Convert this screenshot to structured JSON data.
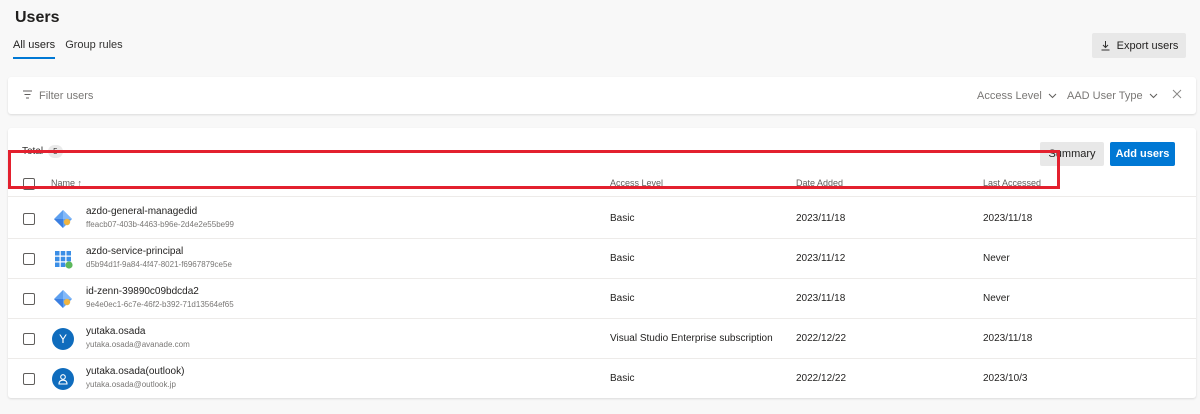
{
  "page": {
    "title": "Users"
  },
  "tabs": [
    {
      "label": "All users",
      "active": true
    },
    {
      "label": "Group rules",
      "active": false
    }
  ],
  "toolbar": {
    "export_label": "Export users"
  },
  "filter": {
    "placeholder": "Filter users",
    "access_level_label": "Access Level",
    "aad_user_type_label": "AAD User Type"
  },
  "summary": {
    "total_label": "Total",
    "total_count": "5",
    "summary_label": "Summary",
    "add_label": "Add users"
  },
  "columns": {
    "name": "Name ↑",
    "access": "Access Level",
    "date_added": "Date Added",
    "last_accessed": "Last Accessed"
  },
  "users": [
    {
      "name": "azdo-general-managedid",
      "id": "ffeacb07-403b-4463-b96e-2d4e2e55be99",
      "access": "Basic",
      "date_added": "2023/11/18",
      "last_accessed": "2023/11/18",
      "avatar": "managed-identity-icon"
    },
    {
      "name": "azdo-service-principal",
      "id": "d5b94d1f-9a84-4f47-8021-f6967879ce5e",
      "access": "Basic",
      "date_added": "2023/11/12",
      "last_accessed": "Never",
      "avatar": "service-principal-icon"
    },
    {
      "name": "id-zenn-39890c09bdcda2",
      "id": "9e4e0ec1-6c7e-46f2-b392-71d13564ef65",
      "access": "Basic",
      "date_added": "2023/11/18",
      "last_accessed": "Never",
      "avatar": "managed-identity-icon"
    },
    {
      "name": "yutaka.osada",
      "id": "yutaka.osada@avanade.com",
      "access": "Visual Studio Enterprise subscription",
      "date_added": "2022/12/22",
      "last_accessed": "2023/11/18",
      "avatar": "user-initial-avatar",
      "initial": "Y"
    },
    {
      "name": "yutaka.osada(outlook)",
      "id": "yutaka.osada@outlook.jp",
      "access": "Basic",
      "date_added": "2022/12/22",
      "last_accessed": "2023/10/3",
      "avatar": "user-person-avatar"
    }
  ],
  "colors": {
    "accent": "#0078d4",
    "highlight": "#e3202e",
    "avatar_blue": "#0f6cbd"
  }
}
